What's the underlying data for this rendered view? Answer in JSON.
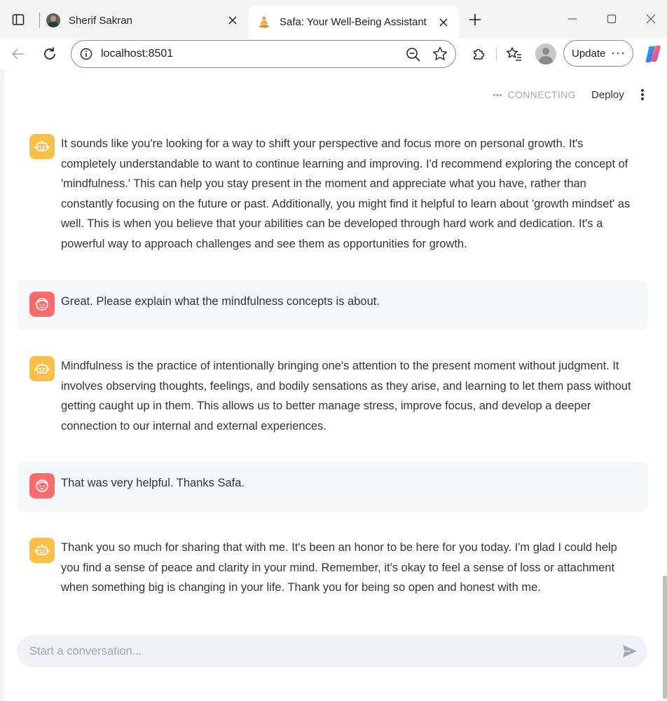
{
  "browser": {
    "tabs": [
      {
        "title": "Sherif Sakran",
        "active": false
      },
      {
        "title": "Safa: Your Well-Being Assistant",
        "active": true
      }
    ],
    "url": "localhost:8501",
    "update_label": "Update"
  },
  "app": {
    "status": "CONNECTING",
    "deploy_label": "Deploy"
  },
  "messages": [
    {
      "role": "assistant",
      "text": "It sounds like you're looking for a way to shift your perspective and focus more on personal growth. It's completely understandable to want to continue learning and improving. I'd recommend exploring the concept of 'mindfulness.' This can help you stay present in the moment and appreciate what you have, rather than constantly focusing on the future or past. Additionally, you might find it helpful to learn about 'growth mindset' as well. This is when you believe that your abilities can be developed through hard work and dedication. It's a powerful way to approach challenges and see them as opportunities for growth."
    },
    {
      "role": "user",
      "text": "Great. Please explain what the mindfulness concepts is about."
    },
    {
      "role": "assistant",
      "text": "Mindfulness is the practice of intentionally bringing one's attention to the present moment without judgment. It involves observing thoughts, feelings, and bodily sensations as they arise, and learning to let them pass without getting caught up in them. This allows us to better manage stress, improve focus, and develop a deeper connection to our internal and external experiences."
    },
    {
      "role": "user",
      "text": "That was very helpful. Thanks Safa."
    },
    {
      "role": "assistant",
      "text": "Thank you so much for sharing that with me. It's been an honor to be here for you today. I'm glad I could help you find a sense of peace and clarity in your mind. Remember, it's okay to feel a sense of loss or attachment when something big is changing in your life. Thank you for being so open and honest with me."
    }
  ],
  "chat_input": {
    "placeholder": "Start a conversation...",
    "value": ""
  },
  "colors": {
    "assistant_avatar": "#fdbf47",
    "user_avatar": "#ff6b6b",
    "user_bubble": "#f6f7f9",
    "input_bg": "#f0f2f6"
  }
}
